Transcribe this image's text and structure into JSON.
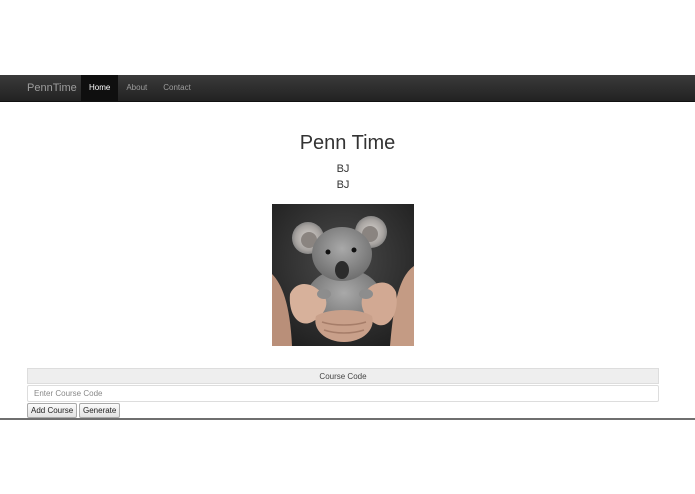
{
  "navbar": {
    "brand": "PennTime",
    "items": [
      {
        "label": "Home",
        "active": true
      },
      {
        "label": "About",
        "active": false
      },
      {
        "label": "Contact",
        "active": false
      }
    ]
  },
  "main": {
    "title": "Penn Time",
    "line1": "BJ",
    "line2": "BJ"
  },
  "course": {
    "header": "Course Code",
    "placeholder": "Enter Course Code",
    "value": "",
    "add_label": "Add Course",
    "generate_label": "Generate"
  },
  "colors": {
    "navbar_bg": "#222222",
    "active_nav_bg": "#0f0f0f",
    "nav_text": "#9d9d9d"
  }
}
